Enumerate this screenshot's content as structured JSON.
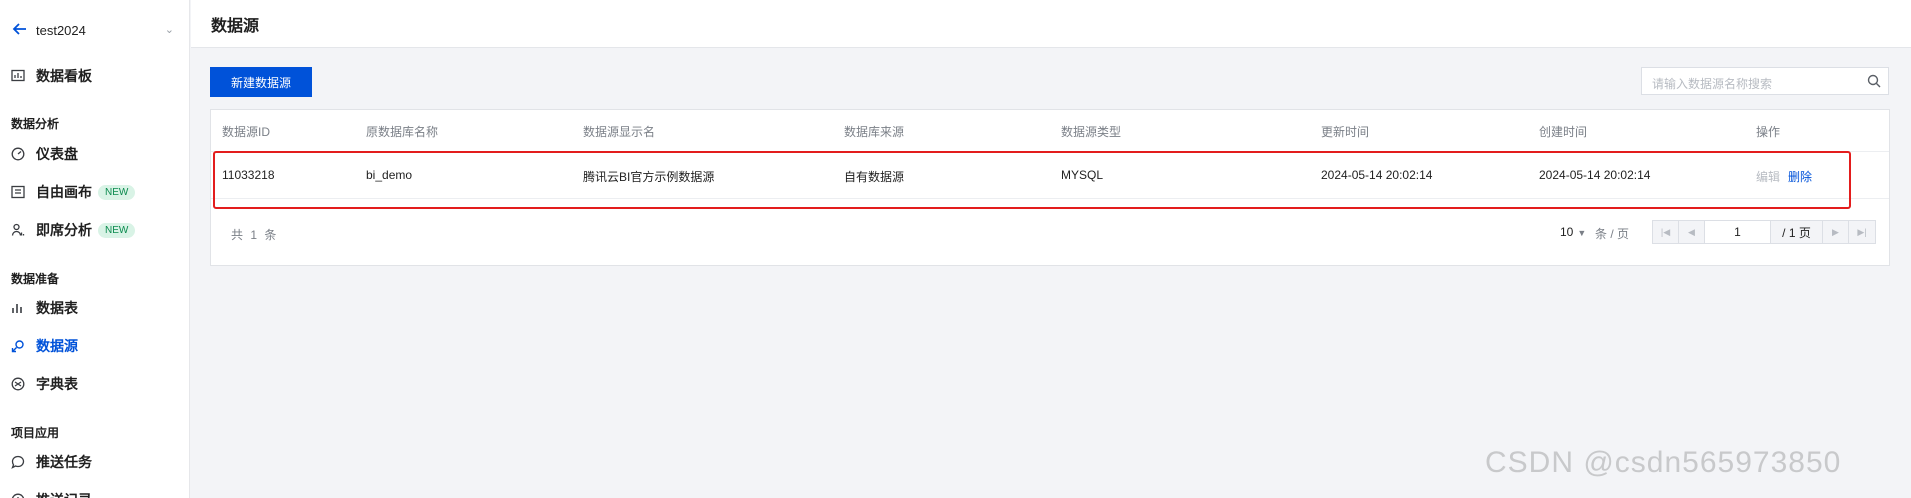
{
  "sidebar": {
    "project_name": "test2024",
    "top_item": {
      "label": "数据看板",
      "icon": "dashboard-icon"
    },
    "groups": [
      {
        "title": "数据分析",
        "items": [
          {
            "label": "仪表盘",
            "icon": "gauge-icon",
            "badge": ""
          },
          {
            "label": "自由画布",
            "icon": "canvas-icon",
            "badge": "NEW"
          },
          {
            "label": "即席分析",
            "icon": "analysis-icon",
            "badge": "NEW"
          }
        ]
      },
      {
        "title": "数据准备",
        "items": [
          {
            "label": "数据表",
            "icon": "bar-chart-icon",
            "badge": ""
          },
          {
            "label": "数据源",
            "icon": "datasource-icon",
            "badge": "",
            "active": true
          },
          {
            "label": "字典表",
            "icon": "dictionary-icon",
            "badge": ""
          }
        ]
      },
      {
        "title": "项目应用",
        "items": [
          {
            "label": "推送任务",
            "icon": "chat-bubble-icon",
            "badge": ""
          },
          {
            "label": "推送记录",
            "icon": "clock-icon",
            "badge": ""
          }
        ]
      }
    ]
  },
  "header": {
    "title": "数据源"
  },
  "toolbar": {
    "new_button": "新建数据源",
    "search_placeholder": "请输入数据源名称搜索"
  },
  "table": {
    "columns": [
      "数据源ID",
      "原数据库名称",
      "数据源显示名",
      "数据库来源",
      "数据源类型",
      "更新时间",
      "创建时间",
      "操作"
    ],
    "rows": [
      {
        "id": "11033218",
        "db_name": "bi_demo",
        "display_name": "腾讯云BI官方示例数据源",
        "source": "自有数据源",
        "type": "MYSQL",
        "updated": "2024-05-14 20:02:14",
        "created": "2024-05-14 20:02:14",
        "edit": "编辑",
        "delete": "删除"
      }
    ]
  },
  "pagination": {
    "total": "共 1 条",
    "page_size": "10",
    "per_page_label": "条 / 页",
    "current_page": "1",
    "total_pages": "/ 1 页"
  },
  "watermark": "CSDN @csdn565973850",
  "colors": {
    "accent": "#0052d9",
    "highlight": "#e31d1d",
    "badge_bg": "#d9f3e6"
  }
}
